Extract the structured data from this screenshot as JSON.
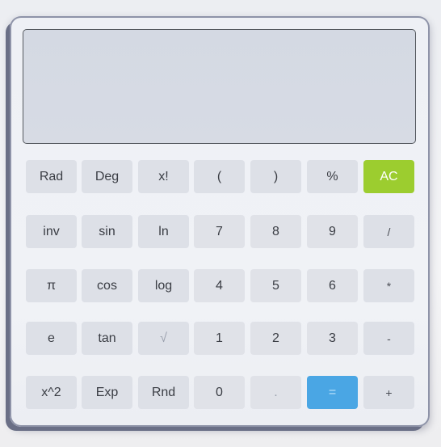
{
  "display": {
    "value": ""
  },
  "keys": {
    "rad": "Rad",
    "deg": "Deg",
    "fact": "x!",
    "lparen": "(",
    "rparen": ")",
    "percent": "%",
    "ac": "AC",
    "inv": "inv",
    "sin": "sin",
    "ln": "ln",
    "seven": "7",
    "eight": "8",
    "nine": "9",
    "divide": "/",
    "pi": "π",
    "cos": "cos",
    "log": "log",
    "four": "4",
    "five": "5",
    "six": "6",
    "multiply": "*",
    "e": "e",
    "tan": "tan",
    "sqrt": "√",
    "one": "1",
    "two": "2",
    "three": "3",
    "minus": "-",
    "square": "x^2",
    "exp": "Exp",
    "rnd": "Rnd",
    "zero": "0",
    "dot": ".",
    "equals": "=",
    "plus": "+"
  },
  "colors": {
    "ac_button": "#9ccd2f",
    "equals_button": "#4aa6e4",
    "key_background": "#dde0e7",
    "display_background": "#d4d9e3"
  }
}
